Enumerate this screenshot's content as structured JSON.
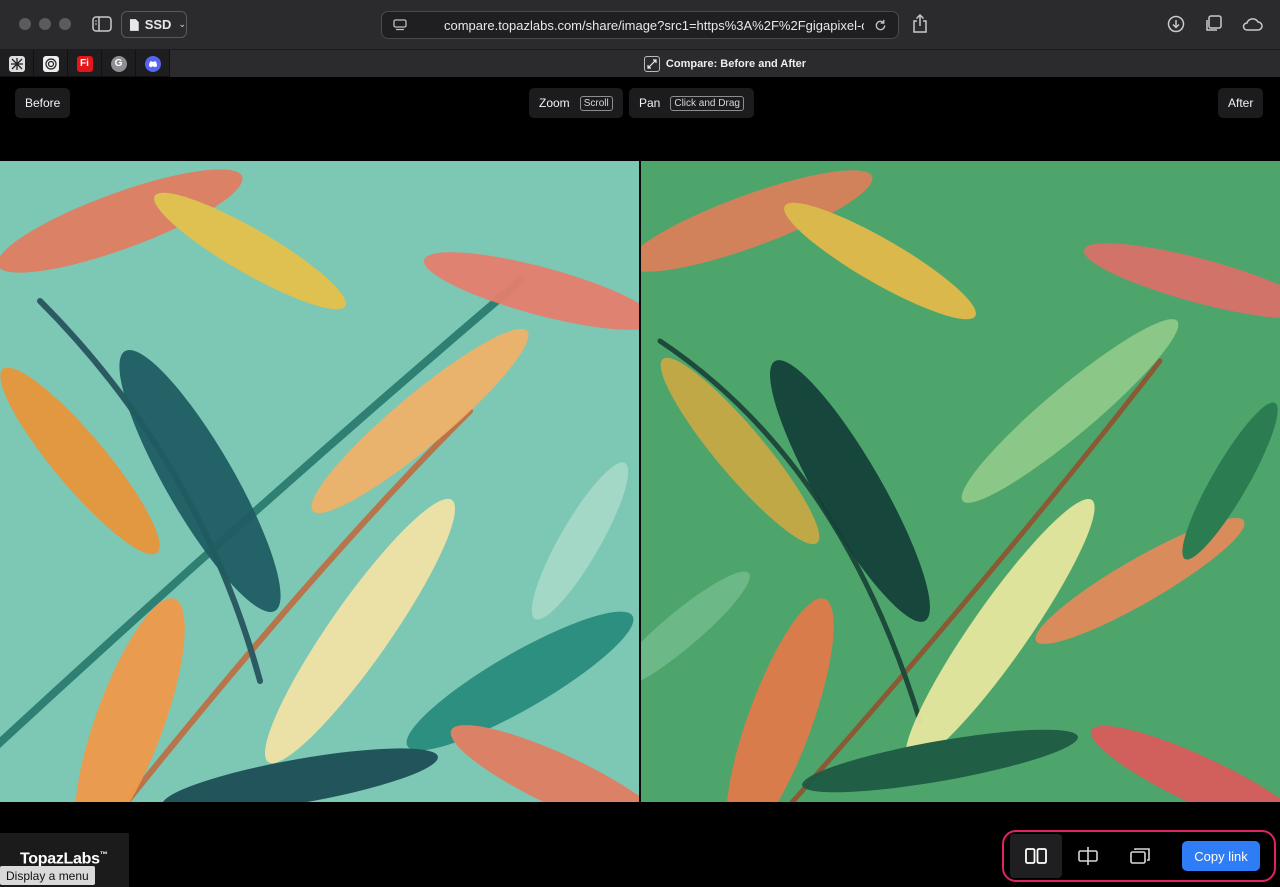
{
  "browser": {
    "profile_label": "SSD",
    "url": "compare.topazlabs.com/share/image?src1=https%3A%2F%2Fgigapixel-clou",
    "active_tab_title": "Compare: Before and After",
    "pinned_tabs": [
      {
        "icon": "grid-app-icon",
        "label": ""
      },
      {
        "icon": "target-app-icon",
        "label": ""
      },
      {
        "icon": "fi-app-icon",
        "label": "Fi"
      },
      {
        "icon": "g-app-icon",
        "label": "G"
      },
      {
        "icon": "discord-icon",
        "label": ""
      }
    ],
    "colors": {
      "chrome": "#2b2b2d",
      "tabstrip": "#1e1e20"
    }
  },
  "viewer": {
    "before_label": "Before",
    "after_label": "After",
    "zoom_label": "Zoom",
    "zoom_hint": "Scroll",
    "pan_label": "Pan",
    "pan_hint": "Click and Drag"
  },
  "footer": {
    "brand_name": "TopazLabs",
    "brand_tm": "™",
    "tooltip": "Display a menu",
    "copy_link_label": "Copy link",
    "view_modes": [
      "side-by-side-icon",
      "split-slider-icon",
      "overlay-icon"
    ],
    "accent": "#2e7cf6",
    "highlight": "#e0245e"
  }
}
